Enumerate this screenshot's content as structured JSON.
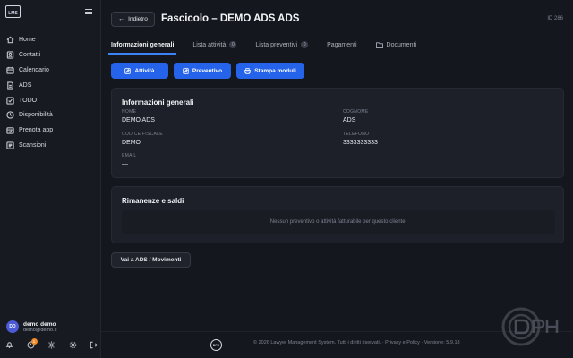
{
  "sidebar": {
    "logo": "LMS",
    "items": [
      {
        "label": "Home",
        "icon": "home-icon"
      },
      {
        "label": "Contatti",
        "icon": "contacts-icon"
      },
      {
        "label": "Calendario",
        "icon": "calendar-icon"
      },
      {
        "label": "ADS",
        "icon": "document-icon"
      },
      {
        "label": "TODO",
        "icon": "checkbox-icon"
      },
      {
        "label": "Disponibilità",
        "icon": "clock-icon"
      },
      {
        "label": "Prenota app",
        "icon": "calendar-check-icon"
      },
      {
        "label": "Scansioni",
        "icon": "scan-icon"
      }
    ],
    "user": {
      "initials": "DD",
      "name": "demo demo",
      "email": "demo@demo.it"
    },
    "bottom_icons": [
      "bell-icon",
      "notifications-icon",
      "sun-icon",
      "settings-icon",
      "logout-icon"
    ],
    "notification_count": "1"
  },
  "header": {
    "back_label": "Indietro",
    "title": "Fascicolo – DEMO ADS ADS",
    "id_label": "ID 286"
  },
  "tabs": [
    {
      "label": "Informazioni generali",
      "active": true
    },
    {
      "label": "Lista attività",
      "count": "0"
    },
    {
      "label": "Lista preventivi",
      "count": "0"
    },
    {
      "label": "Pagamenti"
    },
    {
      "label": "Documenti",
      "icon": "folder-icon"
    }
  ],
  "actions": {
    "attivita": "Attività",
    "preventivo": "Preventivo",
    "stampa": "Stampa moduli"
  },
  "info": {
    "title": "Informazioni generali",
    "nome_label": "NOME",
    "nome": "DEMO ADS",
    "cognome_label": "COGNOME",
    "cognome": "ADS",
    "cf_label": "CODICE FISCALE",
    "cf": "DEMO",
    "tel_label": "TELEFONO",
    "tel": "3333333333",
    "email_label": "EMAIL",
    "email": "—"
  },
  "rimanenze": {
    "title": "Rimanenze e saldi",
    "empty": "Nessun preventivo o attività fatturabile per questo cliente."
  },
  "vai_button": "Vai a ADS / Movimenti",
  "footer": {
    "logo": "DPH",
    "text": "© 2026 Lawyer Management System. Tutti i diritti riservati. · Privacy e Policy · Versione: 5.9.18"
  },
  "colors": {
    "accent": "#2563eb",
    "background": "#14161d",
    "card": "#1d2029"
  }
}
